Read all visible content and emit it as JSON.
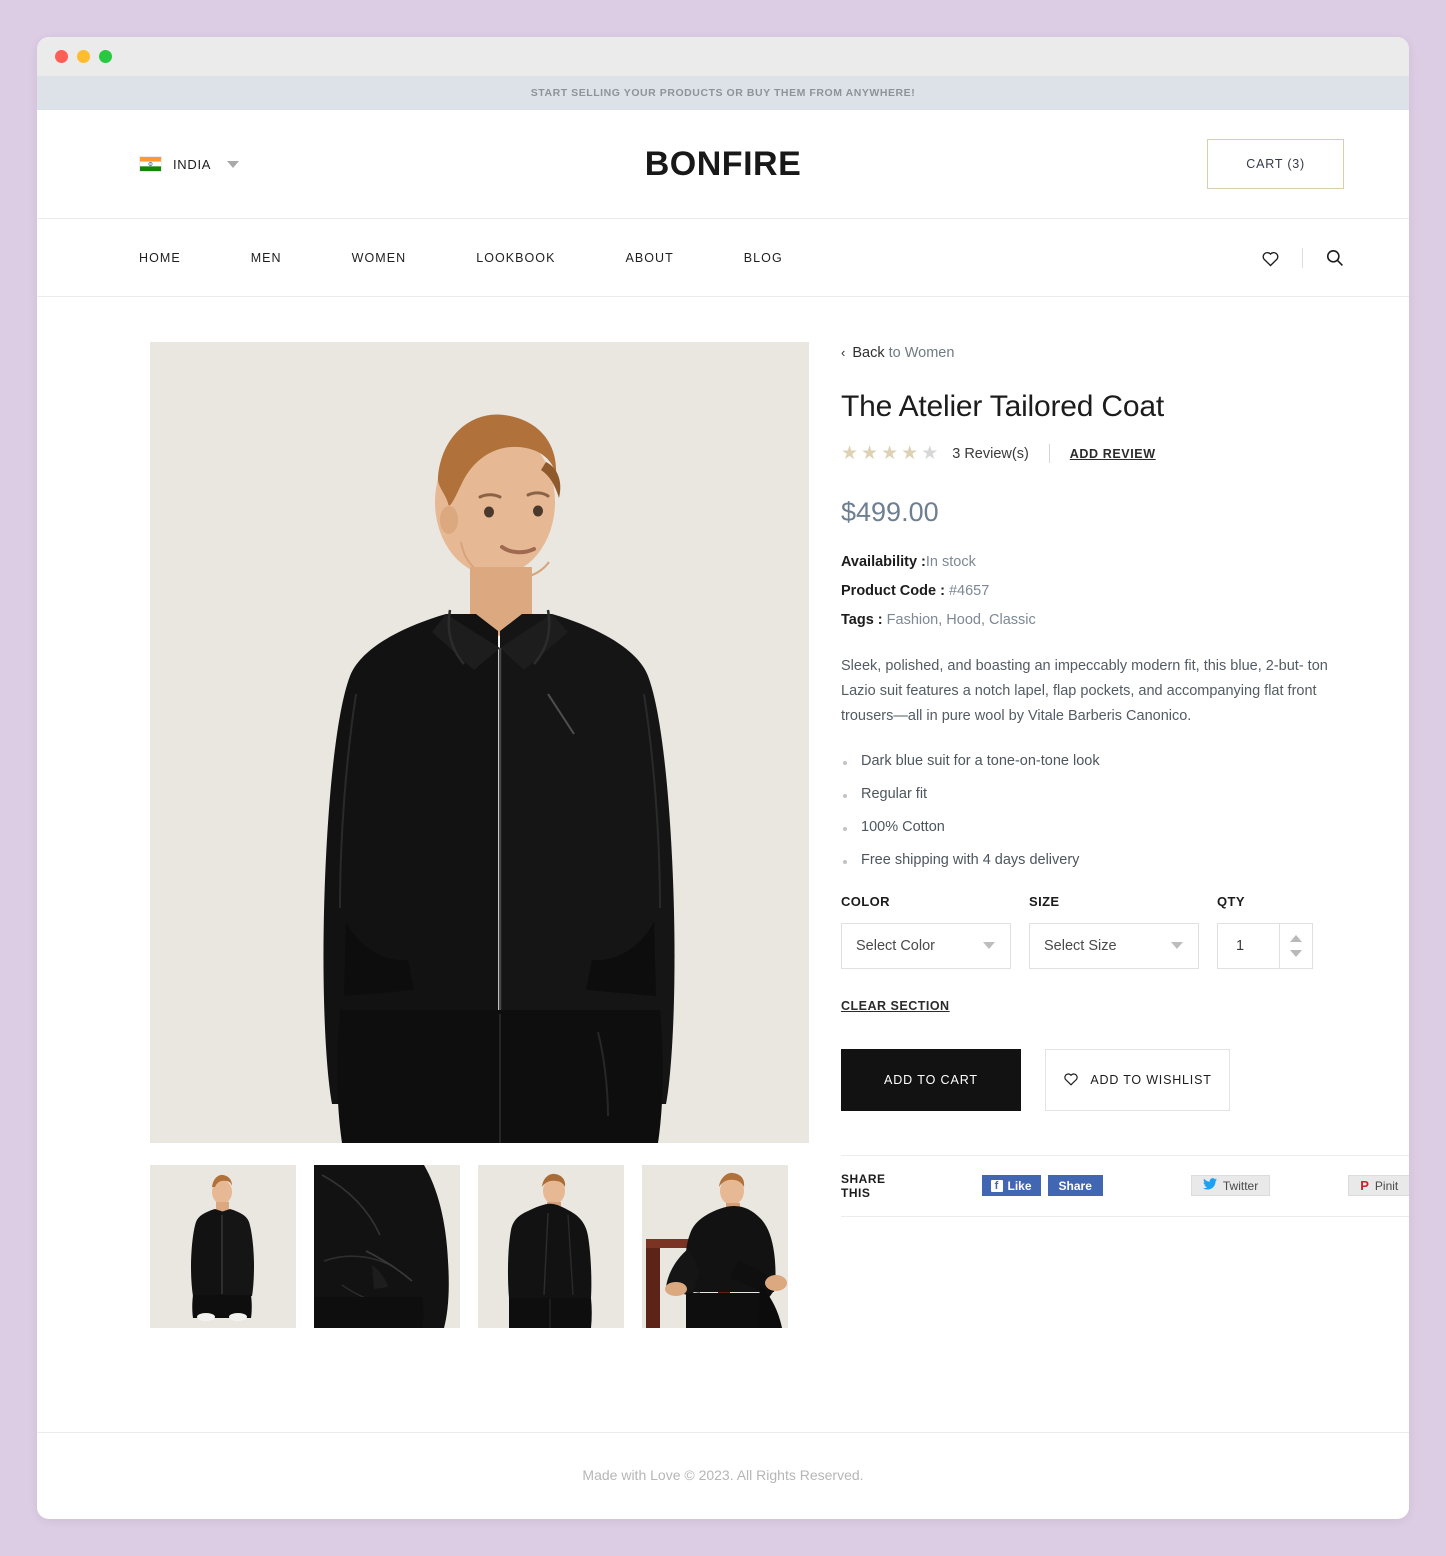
{
  "browser": {
    "traffic_lights": [
      "close",
      "minimize",
      "maximize"
    ]
  },
  "promo": {
    "text": "START SELLING YOUR PRODUCTS OR BUY THEM FROM ANYWHERE!"
  },
  "header": {
    "country": "INDIA",
    "country_flag": "india-flag-icon",
    "brand": "BONFIRE",
    "cart_label": "CART (3)"
  },
  "nav": {
    "items": [
      {
        "label": "HOME"
      },
      {
        "label": "MEN"
      },
      {
        "label": "WOMEN"
      },
      {
        "label": "LOOKBOOK"
      },
      {
        "label": "ABOUT"
      },
      {
        "label": "BLOG"
      }
    ],
    "icons": [
      "heart-icon",
      "search-icon"
    ]
  },
  "product": {
    "back_chevron": "‹",
    "back_prefix": "Back",
    "back_suffix": " to Women",
    "title": "The Atelier Tailored Coat",
    "rating": 4,
    "rating_max": 5,
    "review_count_text": "3 Review(s)",
    "add_review_label": "ADD REVIEW",
    "price": "$499.00",
    "availability_label": "Availability :",
    "availability_value": "In stock",
    "product_code_label": "Product Code : ",
    "product_code_value": "#4657",
    "tags_label": "Tags : ",
    "tags_value": "Fashion, Hood, Classic",
    "description": "Sleek, polished, and boasting an impeccably modern fit, this blue, 2-but- ton Lazio suit features a notch lapel, flap pockets, and accompanying flat front trousers—all in pure wool by Vitale Barberis Canonico.",
    "features": [
      "Dark blue suit for a tone-on-tone look",
      "Regular fit",
      "100% Cotton",
      "Free shipping with 4 days delivery"
    ]
  },
  "options": {
    "color_label": "COLOR",
    "color_value": "Select Color",
    "size_label": "SIZE",
    "size_value": "Select Size",
    "qty_label": "QTY",
    "qty_value": "1",
    "clear_label": "CLEAR SECTION"
  },
  "actions": {
    "add_to_cart": "ADD TO CART",
    "add_to_wishlist": "ADD TO WISHLIST"
  },
  "share": {
    "label": "SHARE THIS",
    "facebook_like": "Like",
    "facebook_like_glyph": "f",
    "facebook_share": "Share",
    "twitter": "Twitter",
    "pinterest": "Pinit",
    "pinterest_glyph": "P"
  },
  "footer": {
    "text": "Made with Love © 2023. All Rights Reserved."
  },
  "colors": {
    "page_background": "#ddcde4",
    "promo_background": "#dde2e8",
    "cart_border": "#d9ceae",
    "price": "#6d7f91",
    "star_filled": "#ded2b4",
    "star_empty": "#d7d7d7",
    "add_to_cart": "#121212",
    "facebook": "#4267b2",
    "twitter": "#1da1f2",
    "pinterest": "#c8232c"
  }
}
